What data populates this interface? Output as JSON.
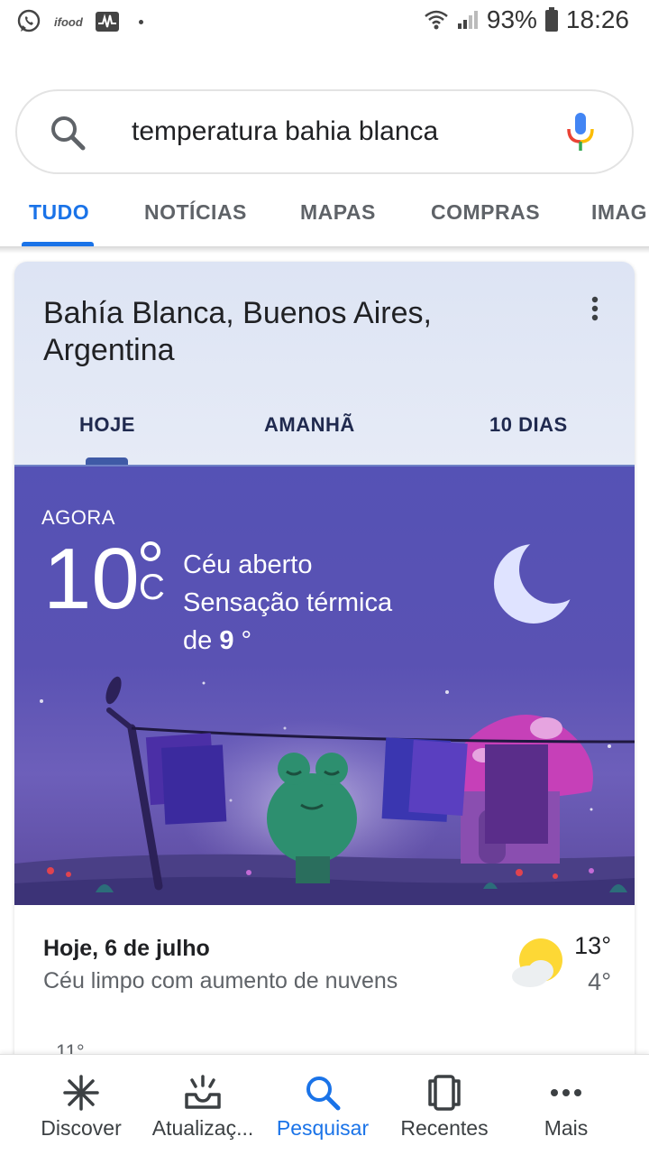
{
  "status_bar": {
    "ifood_label": "ifood",
    "battery": "93%",
    "time": "18:26"
  },
  "search": {
    "query": "temperatura bahia blanca"
  },
  "tabs": [
    {
      "label": "TUDO",
      "active": true
    },
    {
      "label": "NOTÍCIAS",
      "active": false
    },
    {
      "label": "MAPAS",
      "active": false
    },
    {
      "label": "COMPRAS",
      "active": false
    },
    {
      "label": "IMAG",
      "active": false
    }
  ],
  "weather": {
    "location": "Bahía Blanca, Buenos Aires, Argentina",
    "tabs": [
      {
        "label": "HOJE",
        "active": true
      },
      {
        "label": "AMANHÃ",
        "active": false
      },
      {
        "label": "10 DIAS",
        "active": false
      }
    ],
    "now_label": "AGORA",
    "temperature": "10",
    "unit": "C",
    "condition": "Céu aberto",
    "feels_like_prefix": "Sensação térmica",
    "feels_like_de": "de",
    "feels_like_value": "9",
    "feels_like_unit": "°",
    "icon": "moon-icon",
    "day_title": "Hoje, 6 de julho",
    "day_description": "Céu limpo com aumento de nuvens",
    "day_icon": "partly-cloudy-icon",
    "high": "13°",
    "low": "4°",
    "next_value_partial": "11°"
  },
  "bottom_nav": [
    {
      "label": "Discover",
      "icon": "asterisk-icon",
      "active": false
    },
    {
      "label": "Atualizaç...",
      "icon": "updates-icon",
      "active": false
    },
    {
      "label": "Pesquisar",
      "icon": "search-icon",
      "active": true
    },
    {
      "label": "Recentes",
      "icon": "recents-icon",
      "active": false
    },
    {
      "label": "Mais",
      "icon": "more-dots-icon",
      "active": false
    }
  ],
  "colors": {
    "accent": "#1a73e8",
    "scene_sky": "#5552b5"
  }
}
